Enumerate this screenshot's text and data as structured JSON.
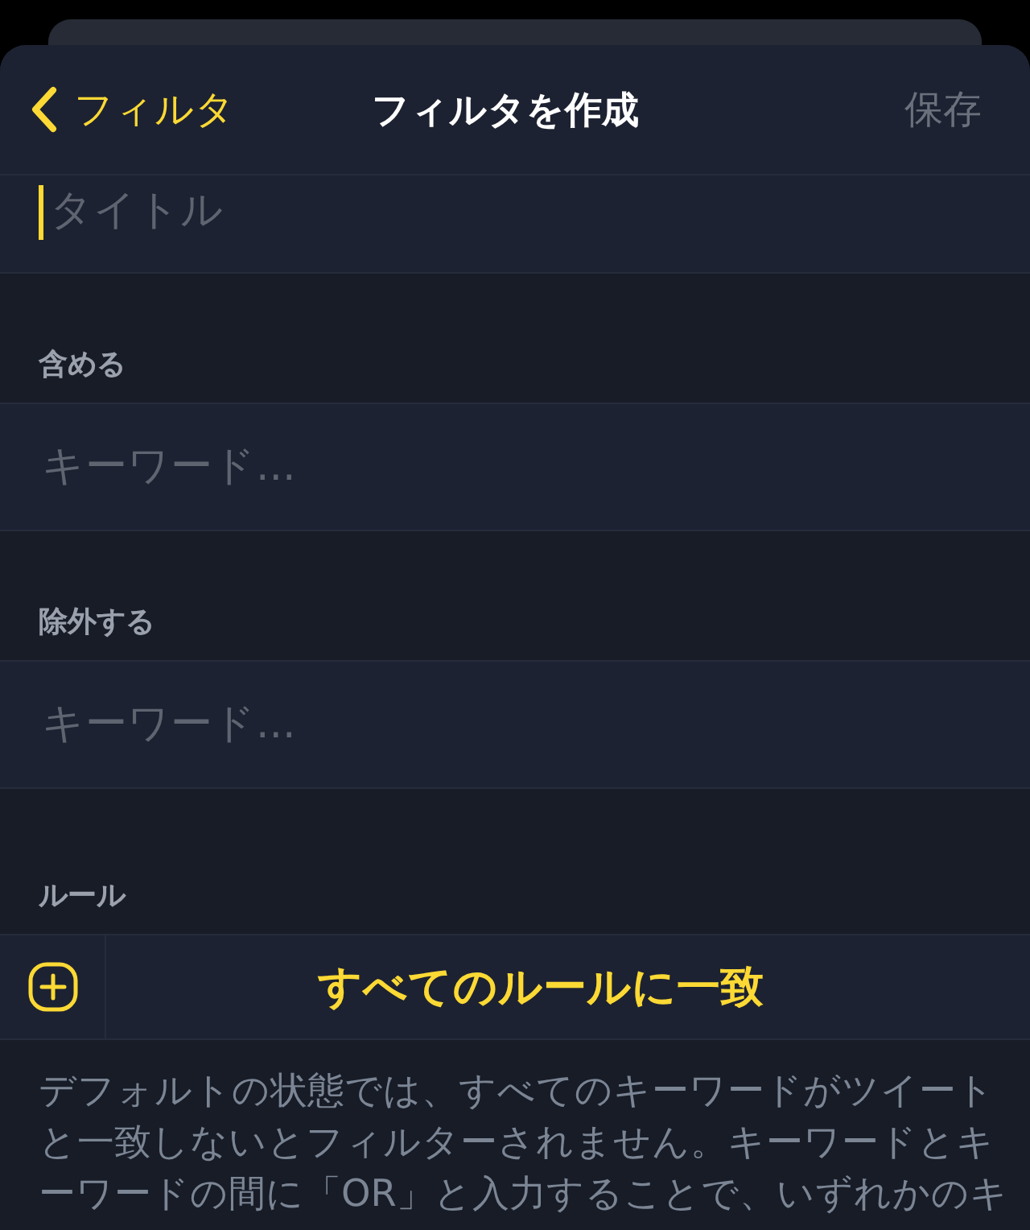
{
  "nav": {
    "back_label": "フィルタ",
    "title": "フィルタを作成",
    "save": {
      "label": "保存",
      "disabled": true
    }
  },
  "title_field": {
    "placeholder": "タイトル",
    "focused": true
  },
  "sections": [
    {
      "header": "含める",
      "placeholder": "キーワード..."
    },
    {
      "header": "除外する",
      "placeholder": "キーワード..."
    }
  ],
  "rules": {
    "header": "ルール",
    "match_label": "すべてのルールに一致"
  },
  "footer": "デフォルトの状態では、すべてのキーワードがツイートと一致しないとフィルターされません。キーワードとキーワードの間に「OR」と入力することで、いずれかのキ"
}
